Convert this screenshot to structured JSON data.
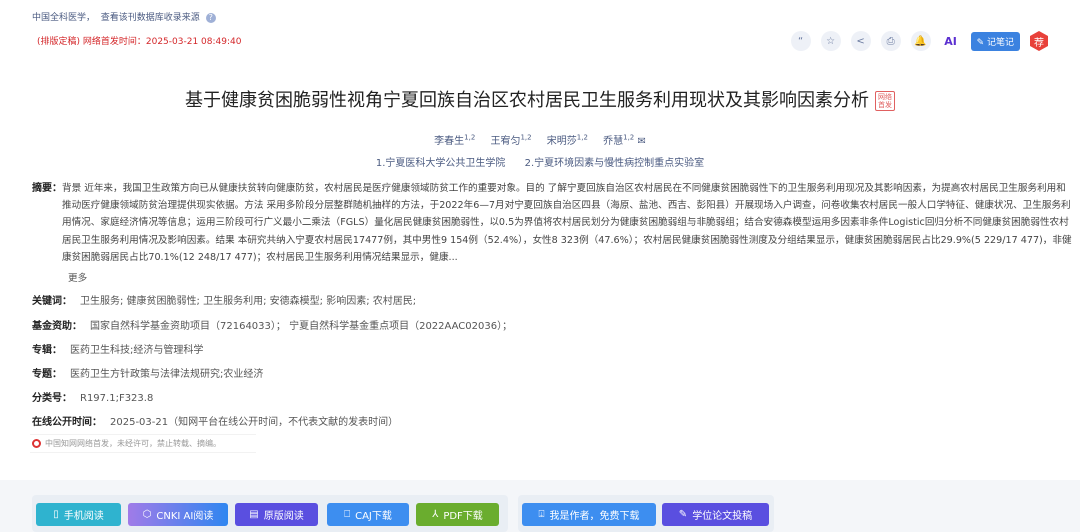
{
  "header": {
    "journal": "中国全科医学，",
    "source_link": "查看该刊数据库收录来源",
    "help_icon": "?",
    "publish_status": "(排版定稿) 网络首发时间：2025-03-21 08:49:40"
  },
  "toolbar": {
    "quote": "“",
    "favorite": "☆",
    "share": "<",
    "print": "⎙",
    "notify": "🔔",
    "ai": "AI",
    "note": "✎ 记笔记",
    "recommend": "荐"
  },
  "title": "基于健康贫困脆弱性视角宁夏回族自治区农村居民卫生服务利用现状及其影响因素分析",
  "title_badge": "网络首发",
  "authors": [
    {
      "name": "李春生",
      "sup": "1,2"
    },
    {
      "name": "王宥匀",
      "sup": "1,2"
    },
    {
      "name": "宋明莎",
      "sup": "1,2"
    },
    {
      "name": "乔慧",
      "sup": "1,2"
    }
  ],
  "affiliations": [
    "1.宁夏医科大学公共卫生学院",
    "2.宁夏环境因素与慢性病控制重点实验室"
  ],
  "abstract": {
    "label": "摘要：",
    "text": "背景 近年来，我国卫生政策方向已从健康扶贫转向健康防贫，农村居民是医疗健康领域防贫工作的重要对象。目的 了解宁夏回族自治区农村居民在不同健康贫困脆弱性下的卫生服务利用现况及其影响因素，为提高农村居民卫生服务利用和推动医疗健康领域防贫治理提供现实依据。方法 采用多阶段分层整群随机抽样的方法，于2022年6—7月对宁夏回族自治区四县（海原、盐池、西吉、彭阳县）开展现场入户调查，问卷收集农村居民一般人口学特征、健康状况、卫生服务利用情况、家庭经济情况等信息；运用三阶段可行广义最小二乘法（FGLS）量化居民健康贫困脆弱性，以0.5为界值将农村居民划分为健康贫困脆弱组与非脆弱组；结合安德森模型运用多因素非条件Logistic回归分析不同健康贫困脆弱性农村居民卫生服务利用情况及影响因素。结果 本研究共纳入宁夏农村居民17477例，其中男性9 154例（52.4%），女性8 323例（47.6%）；农村居民健康贫困脆弱性测度及分组结果显示，健康贫困脆弱居民占比29.9%(5 229/17 477)，非健康贫困脆弱居民占比70.1%(12 248/17 477)；农村居民卫生服务利用情况结果显示，健康...",
    "more": "更多"
  },
  "meta": [
    {
      "label": "关键词：",
      "value": "卫生服务;  健康贫困脆弱性;  卫生服务利用;  安德森模型;  影响因素;  农村居民;"
    },
    {
      "label": "基金资助：",
      "value": "国家自然科学基金资助项目（72164033）；  宁夏自然科学基金重点项目（2022AAC02036）；"
    },
    {
      "label": "专辑：",
      "value": "医药卫生科技;经济与管理科学"
    },
    {
      "label": "专题：",
      "value": "医药卫生方针政策与法律法规研究;农业经济"
    },
    {
      "label": "分类号：",
      "value": "R197.1;F323.8"
    },
    {
      "label": "在线公开时间：",
      "value": "2025-03-21（知网平台在线公开时间，不代表文献的发表时间）"
    }
  ],
  "copyright": "中国知网网络首发，未经许可，禁止转载、摘编。",
  "buttons": [
    "手机阅读",
    "CNKI AI阅读",
    "原版阅读",
    "CAJ下载",
    "PDF下载",
    "我是作者，免费下载",
    "学位论文投稿"
  ],
  "colors": {
    "mobile": "#2fb3cf",
    "ai": "#8a7be8",
    "orig": "#5a4fe0",
    "caj": "#3d8ef0",
    "pdf": "#6aad2e",
    "author": "#3d8ef0",
    "thesis": "#5a4fe0"
  }
}
